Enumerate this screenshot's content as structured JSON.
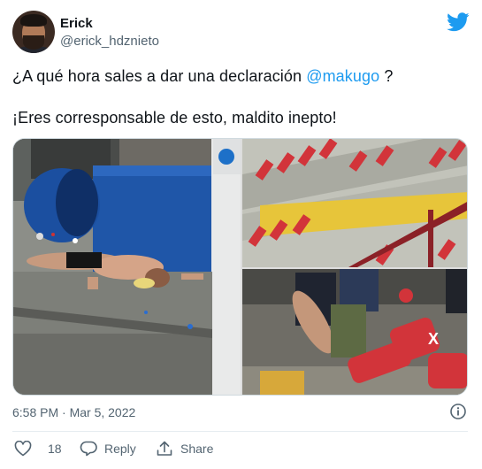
{
  "author": {
    "name": "Erick",
    "handle": "@erick_hdznieto"
  },
  "tweet": {
    "text_before_mention": "¿A qué hora sales a dar una declaración ",
    "mention": "@makugo",
    "text_after_mention": " ?",
    "second_paragraph": "¡Eres corresponsable de esto, maldito inepto!"
  },
  "meta": {
    "timestamp": "6:58 PM · Mar 5, 2022"
  },
  "actions": {
    "like_count": "18",
    "reply_label": "Reply",
    "share_label": "Share"
  },
  "colors": {
    "brand": "#1d9bf0",
    "text_secondary": "#536471",
    "seat_red": "#d2343a",
    "stadium_yellow": "#e7c53a"
  },
  "icons": [
    "twitter-bird-icon",
    "info-icon",
    "heart-icon",
    "reply-icon",
    "share-icon"
  ]
}
